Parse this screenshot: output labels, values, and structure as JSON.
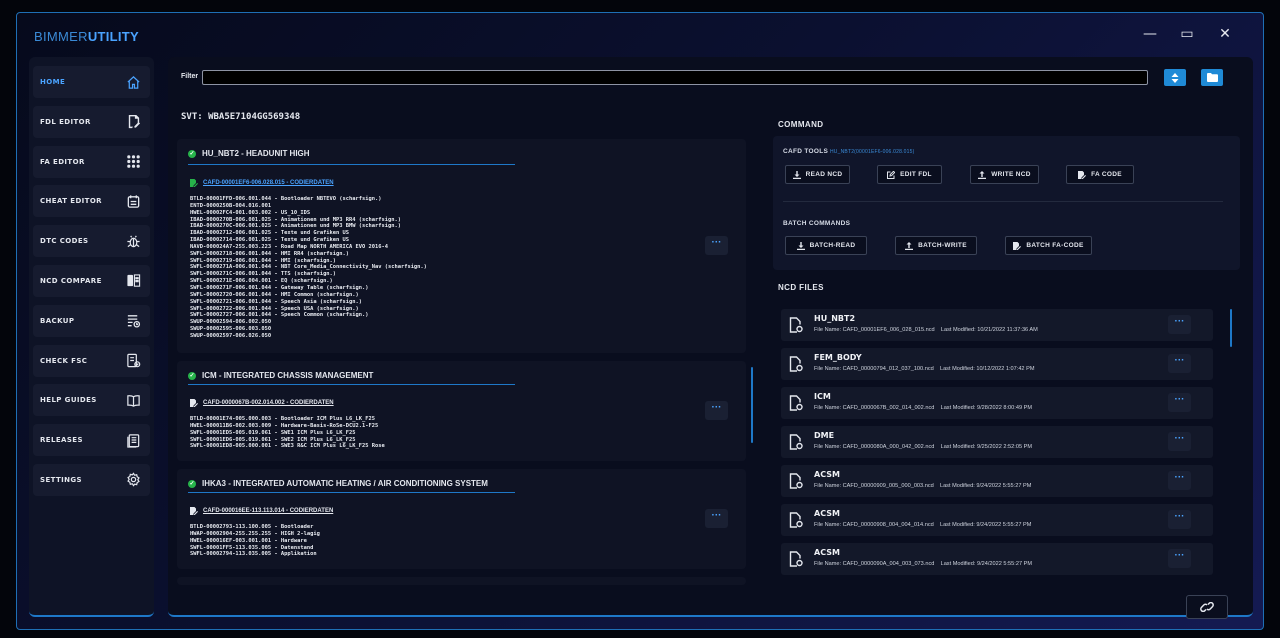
{
  "app": {
    "brand_light": "BIMMER",
    "brand_bold": "UTILITY"
  },
  "window_controls": {
    "minimize": "—",
    "maximize": "▭",
    "close": "✕"
  },
  "sidebar": {
    "items": [
      {
        "label": "HOME",
        "icon": "home-icon",
        "active": true
      },
      {
        "label": "FDL EDITOR",
        "icon": "fdl-editor-icon"
      },
      {
        "label": "FA EDITOR",
        "icon": "grid-icon"
      },
      {
        "label": "CHEAT EDITOR",
        "icon": "cheat-editor-icon"
      },
      {
        "label": "DTC CODES",
        "icon": "bug-icon"
      },
      {
        "label": "NCD COMPARE",
        "icon": "compare-icon"
      },
      {
        "label": "BACKUP",
        "icon": "backup-icon"
      },
      {
        "label": "CHECK FSC",
        "icon": "check-fsc-icon"
      },
      {
        "label": "HELP GUIDES",
        "icon": "book-icon"
      },
      {
        "label": "RELEASES",
        "icon": "releases-icon"
      },
      {
        "label": "SETTINGS",
        "icon": "gear-icon"
      }
    ]
  },
  "filter": {
    "label": "Filter",
    "value": "",
    "placeholder": ""
  },
  "svt": "SVT: WBA5E7104GG569348",
  "ecus": [
    {
      "title": "HU_NBT2 - HEADUNIT HIGH",
      "cafd": "CAFD-00001EF6-006.028.015 - CODIERDATEN",
      "codes": "BTLD-00001FFD-006.001.044 - Bootloader NBTEVO (scharfsign.)\nENTD-0000250B-004.016.001\nHWEL-00002FC4-001.003.002 - US_10_IDS\nIBAD-0000270B-006.001.025 - Animationen und MP3 RR4 (scharfsign.)\nIBAD-0000270C-006.001.025 - Animationen und MP3 BMW (scharfsign.)\nIBAD-00002712-006.001.025 - Texte und Grafiken US\nIBAD-00002714-006.001.025 - Texte und Grafiken US\nNAVD-000024A7-255.003.223 - Road Map NORTH AMERICA EVO 2016-4\nSWFL-00002718-006.001.044 - HMI RR4 (scharfsign.)\nSWFL-00002719-006.001.044 - HMI (scharfsign.)\nSWFL-0000271A-006.001.044 - NBT Core_Media_Connectivity_Nav (scharfsign.)\nSWFL-0000271C-006.001.044 - TTS (scharfsign.)\nSWFL-0000271E-006.004.001 - EQ (scharfsign.)\nSWFL-0000271F-006.001.044 - Gateway Table (scharfsign.)\nSWFL-00002720-006.001.044 - HMI Common (scharfsign.)\nSWFL-00002721-006.001.044 - Speech Asia (scharfsign.)\nSWFL-00002722-006.001.044 - Speech USA (scharfsign.)\nSWFL-00002727-006.001.044 - Speech Common (scharfsign.)\nSWUP-00002594-006.002.050\nSWUP-00002595-006.003.050\nSWUP-00002597-006.026.050"
    },
    {
      "title": "ICM - INTEGRATED CHASSIS MANAGEMENT",
      "cafd": "CAFD-0000067B-002.014.002 - CODIERDATEN",
      "codes": "BTLD-00001E74-005.000.003 - Bootloader ICM Plus L6_LK_F25\nHWEL-000011B6-002.003.009 - Hardware-Basis-RoSe-DCU2.1-F25\nSWFL-00001ED5-005.019.061 - SWE1 ICM Plus L6_LK_F25\nSWFL-00001ED6-005.019.061 - SWE2 ICM Plus L6_LK_F25\nSWFL-00001ED8-005.000.001 - SWE3 R&C ICM Plus L6_LK_F25 Rose"
    },
    {
      "title": "IHKA3 - INTEGRATED AUTOMATIC HEATING / AIR CONDITIONING SYSTEM",
      "cafd": "CAFD-000016EE-113.113.014 - CODIERDATEN",
      "codes": "BTLD-00002793-113.100.005 - Bootloader\nHWAP-00002904-255.255.255 - HIGH 2-lagig\nHWEL-000016EF-003.001.001 - Hardware\nSWFL-00001FF5-113.035.005 - Datenstand\nSWFL-00002794-113.035.005 - Applikation"
    }
  ],
  "command": {
    "title": "COMMAND",
    "cafd_tools_label": "CAFD TOOLS",
    "cafd_tag": "HU_NBT2(00001EF6-006.028.015)",
    "read_ncd": "READ NCD",
    "edit_fdl": "EDIT FDL",
    "write_ncd": "WRITE NCD",
    "fa_code": "FA CODE",
    "batch_label": "BATCH COMMANDS",
    "batch_read": "BATCH-READ",
    "batch_write": "BATCH-WRITE",
    "batch_fa_code": "BATCH FA-CODE"
  },
  "ncd_files": {
    "title": "NCD FILES",
    "items": [
      {
        "name": "HU_NBT2",
        "file": "File Name: CAFD_00001EF6_006_028_015.ncd",
        "modified": "Last Modified: 10/21/2022 11:37:36 AM"
      },
      {
        "name": "FEM_BODY",
        "file": "File Name: CAFD_00000794_012_037_100.ncd",
        "modified": "Last Modified: 10/12/2022 1:07:42 PM"
      },
      {
        "name": "ICM",
        "file": "File Name: CAFD_0000067B_002_014_002.ncd",
        "modified": "Last Modified: 9/28/2022 8:00:49 PM"
      },
      {
        "name": "DME",
        "file": "File Name: CAFD_0000080A_000_042_002.ncd",
        "modified": "Last Modified: 9/25/2022 2:52:05 PM"
      },
      {
        "name": "ACSM",
        "file": "File Name: CAFD_00000909_005_000_003.ncd",
        "modified": "Last Modified: 9/24/2022 5:55:27 PM"
      },
      {
        "name": "ACSM",
        "file": "File Name: CAFD_00000908_004_004_014.ncd",
        "modified": "Last Modified: 9/24/2022 5:55:27 PM"
      },
      {
        "name": "ACSM",
        "file": "File Name: CAFD_0000090A_004_003_073.ncd",
        "modified": "Last Modified: 9/24/2022 5:55:27 PM"
      }
    ]
  },
  "colors": {
    "accent": "#1f8ad6",
    "link": "#4aa3ff",
    "ok": "#27b34a"
  }
}
